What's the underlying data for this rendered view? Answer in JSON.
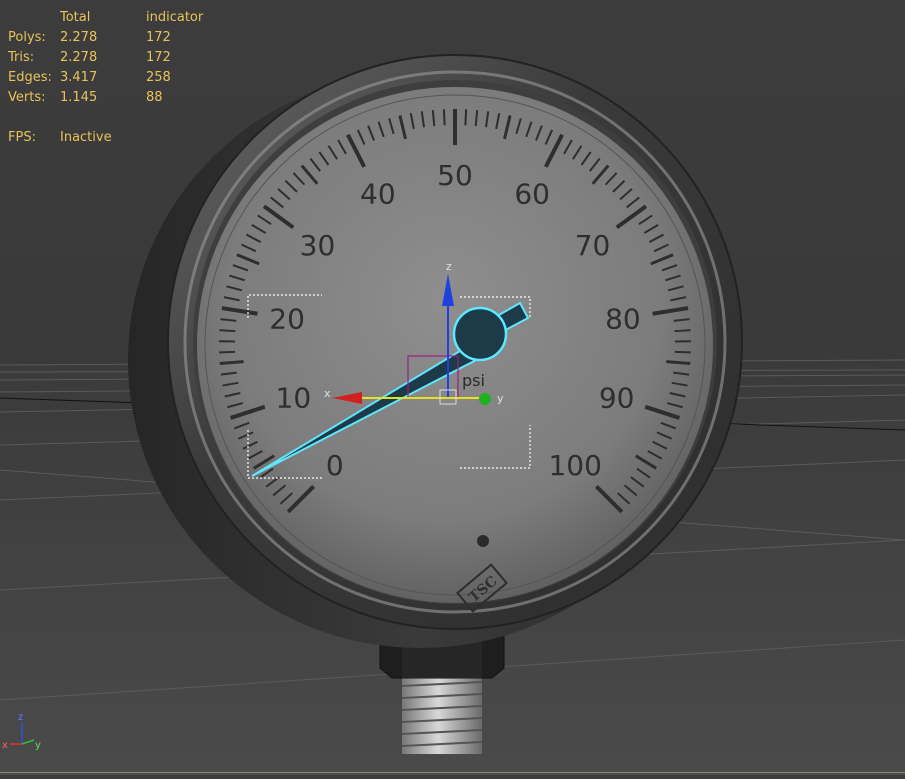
{
  "stats": {
    "header": {
      "total": "Total",
      "selected": "indicator"
    },
    "rows": [
      {
        "label": "Polys:",
        "total": "2.278",
        "selected": "172"
      },
      {
        "label": "Tris:",
        "total": "2.278",
        "selected": "172"
      },
      {
        "label": "Edges:",
        "total": "3.417",
        "selected": "258"
      },
      {
        "label": "Verts:",
        "total": "1.145",
        "selected": "88"
      }
    ],
    "fps": {
      "label": "FPS:",
      "value": "Inactive"
    }
  },
  "gauge": {
    "scale_labels": [
      "0",
      "10",
      "20",
      "30",
      "40",
      "50",
      "60",
      "70",
      "80",
      "90",
      "100"
    ],
    "unit": "psi",
    "logo": "TSC"
  },
  "gizmo": {
    "x": "x",
    "y": "y",
    "z": "z"
  },
  "axis_indicator": {
    "x": "x",
    "y": "y",
    "z": "z"
  },
  "colors": {
    "stats_text": "#e8c35a",
    "selection_highlight": "#5fe6ff",
    "gizmo_x": "#d02020",
    "gizmo_y": "#e8e020",
    "gizmo_z": "#2040e0"
  }
}
